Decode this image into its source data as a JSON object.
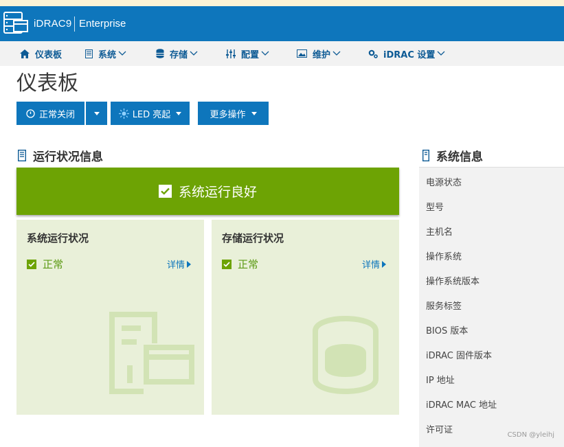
{
  "app": {
    "brand": "iDRAC9",
    "edition": "Enterprise"
  },
  "nav": [
    {
      "label": "仪表板",
      "icon": "home-icon",
      "dropdown": false
    },
    {
      "label": "系统",
      "icon": "server-icon",
      "dropdown": true
    },
    {
      "label": "存储",
      "icon": "database-icon",
      "dropdown": true
    },
    {
      "label": "配置",
      "icon": "sliders-icon",
      "dropdown": true
    },
    {
      "label": "维护",
      "icon": "image-icon",
      "dropdown": true
    },
    {
      "label": "iDRAC 设置",
      "icon": "gears-icon",
      "dropdown": true
    }
  ],
  "page": {
    "title": "仪表板"
  },
  "actions": {
    "shutdown_label": "正常关闭",
    "led_label": "LED 亮起",
    "more_label": "更多操作"
  },
  "health": {
    "section_title": "运行状况信息",
    "overall": "系统运行良好",
    "cards": [
      {
        "title": "系统运行状况",
        "status": "正常",
        "link": "详情"
      },
      {
        "title": "存储运行状况",
        "status": "正常",
        "link": "详情"
      }
    ]
  },
  "sysinfo": {
    "section_title": "系统信息",
    "rows": [
      "电源状态",
      "型号",
      "主机名",
      "操作系统",
      "操作系统版本",
      "服务标签",
      "BIOS 版本",
      "iDRAC 固件版本",
      "IP 地址",
      "iDRAC MAC 地址",
      "许可证"
    ]
  },
  "watermark": "CSDN @yleihj",
  "colors": {
    "header": "#0e76bc",
    "nav_text": "#0e5b95",
    "healthy": "#6da304",
    "card_bg": "#e9f0d9"
  }
}
